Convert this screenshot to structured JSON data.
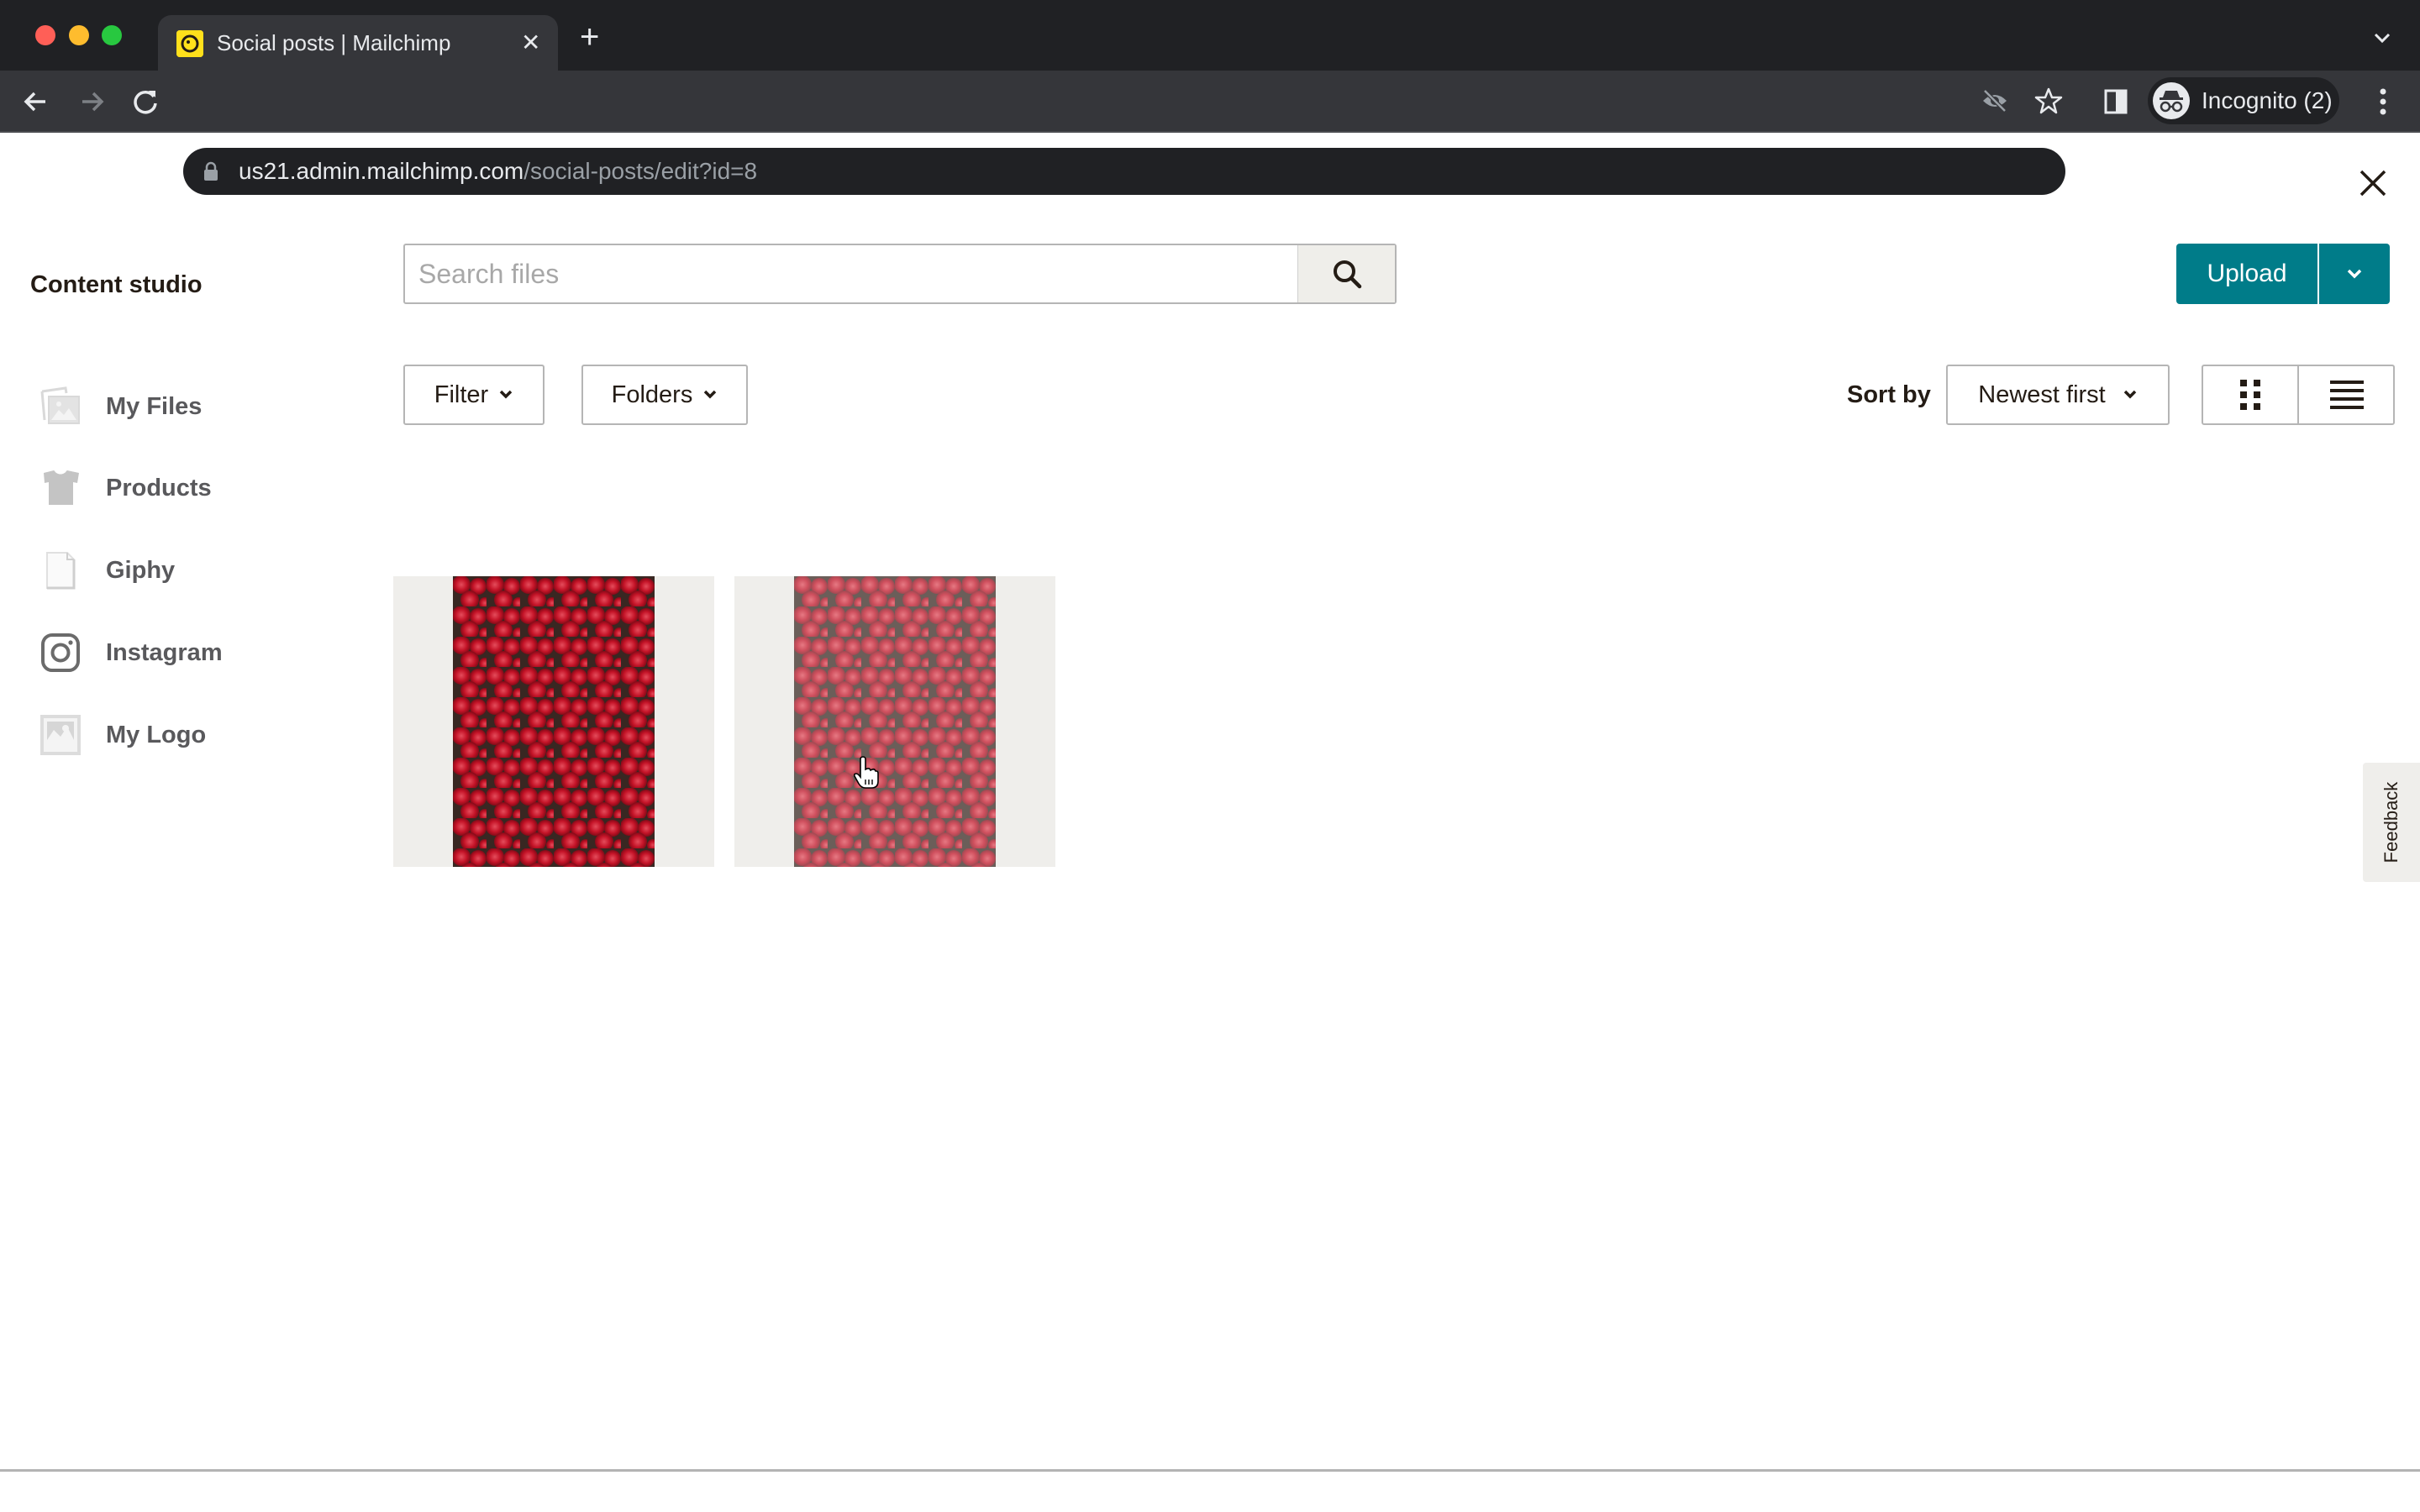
{
  "browser": {
    "tab_title": "Social posts | Mailchimp",
    "favicon": "mailchimp-freddie-icon",
    "url_host": "us21.admin.mailchimp.com",
    "url_path": "/social-posts/edit?id=8",
    "profile_label": "Incognito (2)",
    "traffic_light_colors": {
      "close": "#ff5f57",
      "minimize": "#febc2e",
      "maximize": "#28c840"
    }
  },
  "modal": {
    "title": "Content studio",
    "close_icon": "close-icon"
  },
  "search": {
    "placeholder": "Search files",
    "value": ""
  },
  "upload": {
    "label": "Upload",
    "menu_icon": "chevron-down-icon",
    "color": "#007c89"
  },
  "toolbar": {
    "filter_label": "Filter",
    "folders_label": "Folders",
    "sort_label": "Sort by",
    "sort_value": "Newest first",
    "view_modes": [
      "grid",
      "list"
    ],
    "active_view": "grid"
  },
  "sidebar": {
    "items": [
      {
        "label": "My Files",
        "icon": "images-icon"
      },
      {
        "label": "Products",
        "icon": "tshirt-icon"
      },
      {
        "label": "Giphy",
        "icon": "file-icon"
      },
      {
        "label": "Instagram",
        "icon": "instagram-icon"
      },
      {
        "label": "My Logo",
        "icon": "image-icon"
      }
    ]
  },
  "files": [
    {
      "type": "image",
      "subject": "red begonia flowers",
      "hovered": false
    },
    {
      "type": "image",
      "subject": "red begonia flowers",
      "hovered": true
    }
  ],
  "feedback": {
    "label": "Feedback"
  }
}
